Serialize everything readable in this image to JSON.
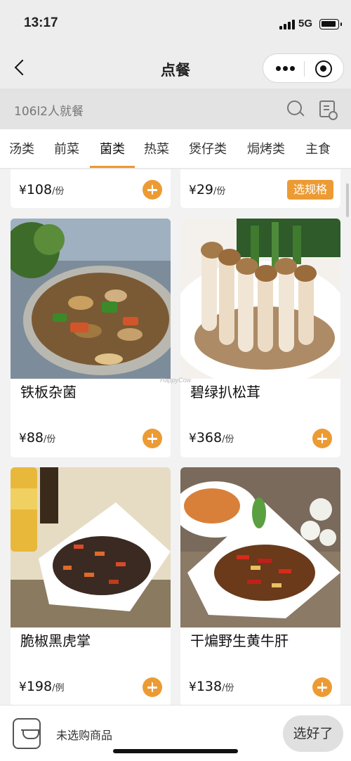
{
  "status_bar": {
    "time": "13:17",
    "network": "5G"
  },
  "nav": {
    "title": "点餐"
  },
  "info": {
    "table_text": "106l2人就餐"
  },
  "tabs": [
    {
      "label": "汤类",
      "active": false
    },
    {
      "label": "前菜",
      "active": false
    },
    {
      "label": "菌类",
      "active": true
    },
    {
      "label": "热菜",
      "active": false
    },
    {
      "label": "煲仔类",
      "active": false
    },
    {
      "label": "焗烤类",
      "active": false
    },
    {
      "label": "主食",
      "active": false
    }
  ],
  "menu": {
    "partial_items": [
      {
        "currency": "¥",
        "price": "108",
        "unit": "/份",
        "action": "add"
      },
      {
        "currency": "¥",
        "price": "29",
        "unit": "/份",
        "action": "spec",
        "spec_label": "选规格"
      }
    ],
    "items": [
      {
        "name": "铁板杂菌",
        "currency": "¥",
        "price": "88",
        "unit": "/份"
      },
      {
        "name": "碧绿扒松茸",
        "currency": "¥",
        "price": "368",
        "unit": "/份"
      },
      {
        "name": "脆椒黑虎掌",
        "currency": "¥",
        "price": "198",
        "unit": "/例"
      },
      {
        "name": "干煸野生黄牛肝",
        "currency": "¥",
        "price": "138",
        "unit": "/份"
      }
    ],
    "watermark": "HappyCow"
  },
  "cart": {
    "status": "未选购商品",
    "done_label": "选好了"
  },
  "colors": {
    "accent": "#ec9b34",
    "tab_underline": "#e89a2f",
    "background": "#ededed"
  }
}
